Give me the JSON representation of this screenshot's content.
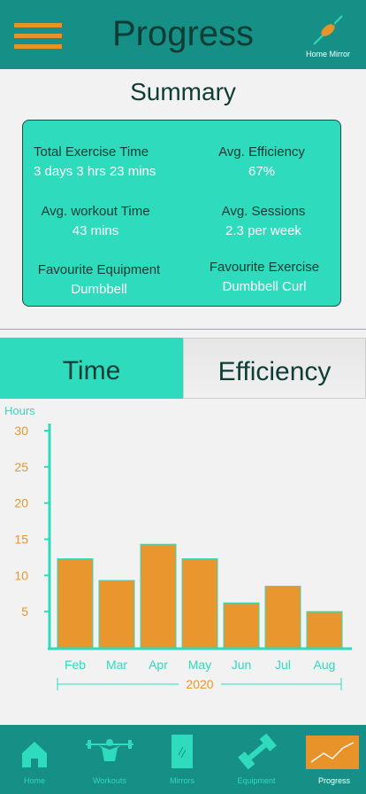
{
  "header": {
    "title": "Progress",
    "menu_icon": "hamburger-menu-icon",
    "home_mirror_label": "Home Mirror"
  },
  "summary": {
    "title": "Summary",
    "stats": [
      {
        "label": "Total Exercise Time",
        "value": "3 days 3 hrs 23 mins"
      },
      {
        "label": "Avg. Efficiency",
        "value": "67%"
      },
      {
        "label": "Avg. workout Time",
        "value": "43 mins"
      },
      {
        "label": "Avg. Sessions",
        "value": "2.3 per week"
      },
      {
        "label": "Favourite Equipment",
        "value": "Dumbbell"
      },
      {
        "label": "Favourite Exercise",
        "value": "Dumbbell Curl"
      }
    ]
  },
  "tabs": [
    {
      "label": "Time",
      "active": true
    },
    {
      "label": "Efficiency",
      "active": false
    }
  ],
  "chart_data": {
    "type": "bar",
    "ylabel": "Hours",
    "xlabel": "2020",
    "categories": [
      "Feb",
      "Mar",
      "Apr",
      "May",
      "Jun",
      "Jul",
      "Aug"
    ],
    "values": [
      12.3,
      9.3,
      14.3,
      12.3,
      6.2,
      8.5,
      5.0
    ],
    "ylim": [
      0,
      30
    ],
    "yticks": [
      5,
      10,
      15,
      20,
      25,
      30
    ],
    "grid": false,
    "colors": {
      "bar": "#e8962d",
      "axis": "#2edbbd",
      "tick_label": "#e8962d",
      "category_label": "#2edbbd"
    }
  },
  "bottom_nav": [
    {
      "label": "Home",
      "icon": "home-icon",
      "active": false
    },
    {
      "label": "Workouts",
      "icon": "barbell-lifter-icon",
      "active": false
    },
    {
      "label": "Mirrors",
      "icon": "mirror-icon",
      "active": false
    },
    {
      "label": "Equipment",
      "icon": "dumbbell-icon",
      "active": false
    },
    {
      "label": "Progress",
      "icon": "progress-chart-icon",
      "active": true
    }
  ],
  "colors": {
    "primary": "#168f86",
    "accent": "#2edbbd",
    "orange": "#e8922a",
    "dark_text": "#0e3d36"
  }
}
